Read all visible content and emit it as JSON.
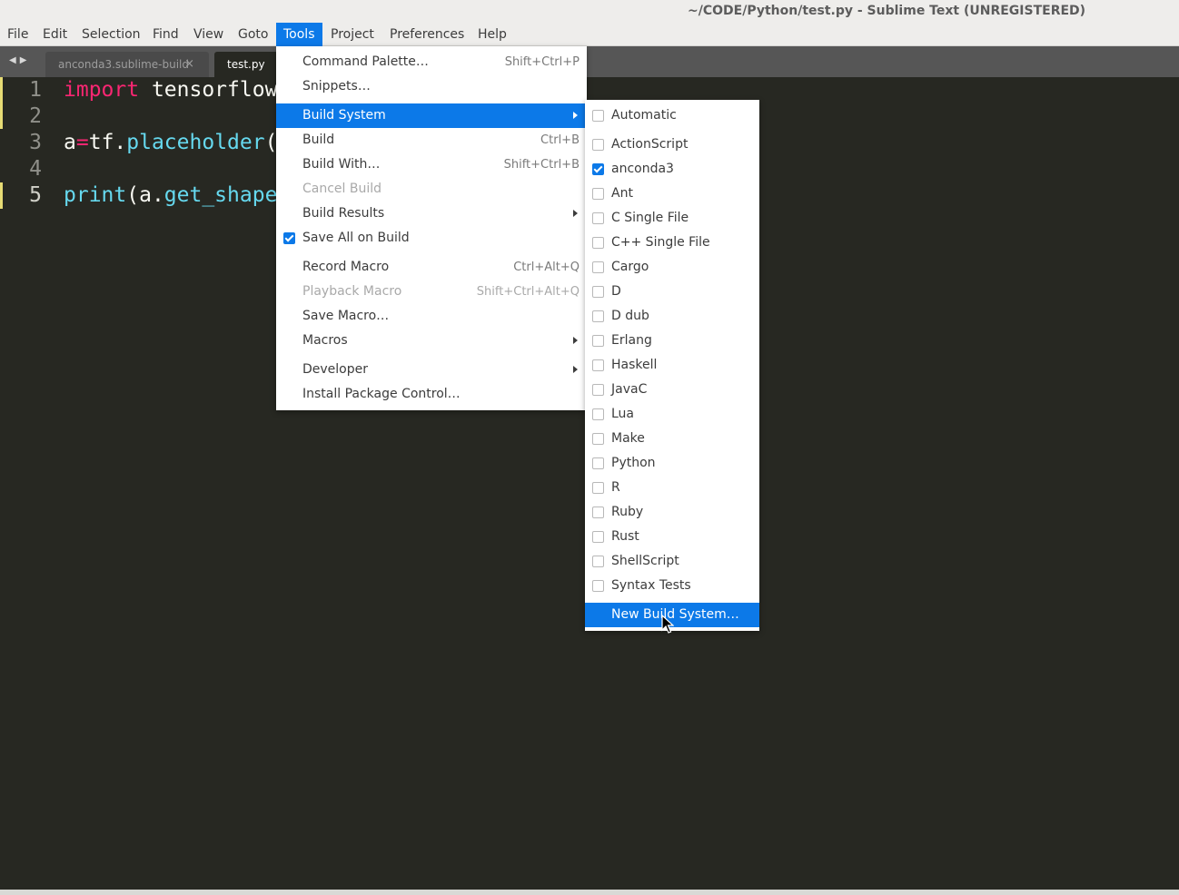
{
  "window": {
    "title": "~/CODE/Python/test.py - Sublime Text (UNREGISTERED)"
  },
  "menubar": {
    "items": [
      "File",
      "Edit",
      "Selection",
      "Find",
      "View",
      "Goto",
      "Tools",
      "Project",
      "Preferences",
      "Help"
    ],
    "active": "Tools"
  },
  "tabs": [
    {
      "label": "anconda3.sublime-build",
      "close": "×",
      "active": false
    },
    {
      "label": "test.py",
      "active": true
    }
  ],
  "nav": {
    "back": "◀",
    "forward": "▶"
  },
  "editor": {
    "line_numbers": [
      "1",
      "2",
      "3",
      "4",
      "5"
    ],
    "lines": [
      {
        "kw": "import",
        "rest": " tensorflow"
      },
      {
        "text": ""
      },
      {
        "a": "a",
        "op": "=",
        "obj": "tf.",
        "fn": "placeholder",
        "rest": "("
      },
      {
        "text": ""
      },
      {
        "fn": "print",
        "p1": "(a.",
        "fn2": "get_shape"
      }
    ]
  },
  "tools_menu": {
    "items": [
      {
        "label": "Command Palette…",
        "shortcut": "Shift+Ctrl+P"
      },
      {
        "label": "Snippets…",
        "shortcut": ""
      },
      {
        "label": "Build System",
        "submenu": true,
        "highlighted": true
      },
      {
        "label": "Build",
        "shortcut": "Ctrl+B"
      },
      {
        "label": "Build With…",
        "shortcut": "Shift+Ctrl+B"
      },
      {
        "label": "Cancel Build",
        "disabled": true
      },
      {
        "label": "Build Results",
        "submenu": true
      },
      {
        "label": "Save All on Build",
        "checked": true
      },
      {
        "label": "Record Macro",
        "shortcut": "Ctrl+Alt+Q"
      },
      {
        "label": "Playback Macro",
        "shortcut": "Shift+Ctrl+Alt+Q",
        "disabled": true
      },
      {
        "label": "Save Macro…"
      },
      {
        "label": "Macros",
        "submenu": true
      },
      {
        "label": "Developer",
        "submenu": true
      },
      {
        "label": "Install Package Control…"
      }
    ]
  },
  "build_system_menu": {
    "items": [
      {
        "label": "Automatic",
        "checked": false
      },
      {
        "label": "ActionScript",
        "checked": false
      },
      {
        "label": "anconda3",
        "checked": true
      },
      {
        "label": "Ant",
        "checked": false
      },
      {
        "label": "C Single File",
        "checked": false
      },
      {
        "label": "C++ Single File",
        "checked": false
      },
      {
        "label": "Cargo",
        "checked": false
      },
      {
        "label": "D",
        "checked": false
      },
      {
        "label": "D dub",
        "checked": false
      },
      {
        "label": "Erlang",
        "checked": false
      },
      {
        "label": "Haskell",
        "checked": false
      },
      {
        "label": "JavaC",
        "checked": false
      },
      {
        "label": "Lua",
        "checked": false
      },
      {
        "label": "Make",
        "checked": false
      },
      {
        "label": "Python",
        "checked": false
      },
      {
        "label": "R",
        "checked": false
      },
      {
        "label": "Ruby",
        "checked": false
      },
      {
        "label": "Rust",
        "checked": false
      },
      {
        "label": "ShellScript",
        "checked": false
      },
      {
        "label": "Syntax Tests",
        "checked": false
      },
      {
        "label": "New Build System…",
        "highlighted": true
      }
    ]
  },
  "colors": {
    "accent": "#0c79e8",
    "editor_bg": "#272822",
    "keyword": "#f92672",
    "function": "#66d9ef"
  }
}
